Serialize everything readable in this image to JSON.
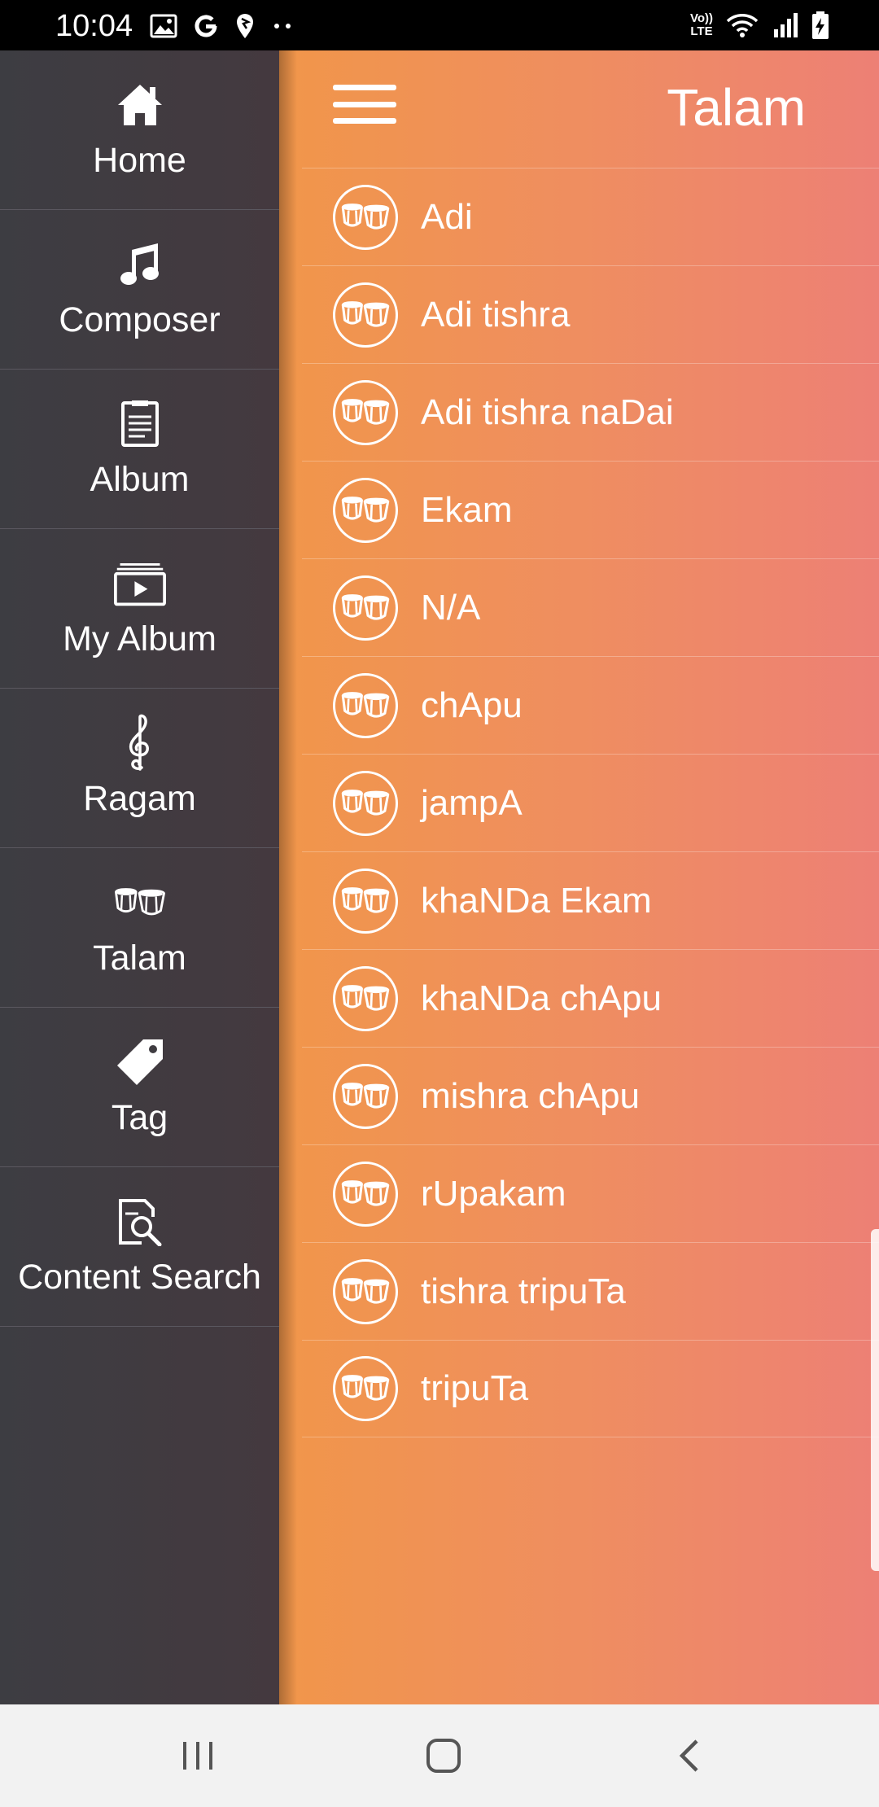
{
  "status_bar": {
    "time": "10:04",
    "left_icons": [
      "image-icon",
      "google-icon",
      "location-icon",
      "more-dots-icon"
    ],
    "volte_label_top": "Vo))",
    "volte_label_bottom": "LTE",
    "right_icons": [
      "wifi-icon",
      "signal-icon",
      "battery-charging-icon"
    ]
  },
  "drawer": {
    "items": [
      {
        "label": "Home",
        "icon": "home-icon"
      },
      {
        "label": "Composer",
        "icon": "music-note-icon"
      },
      {
        "label": "Album",
        "icon": "album-sheet-icon"
      },
      {
        "label": "My Album",
        "icon": "video-folder-icon"
      },
      {
        "label": "Ragam",
        "icon": "treble-clef-icon"
      },
      {
        "label": "Talam",
        "icon": "drums-icon"
      },
      {
        "label": "Tag",
        "icon": "tag-icon"
      },
      {
        "label": "Content Search",
        "icon": "content-search-icon"
      }
    ]
  },
  "toolbar": {
    "title": "Talam",
    "menu_icon": "hamburger-menu-icon"
  },
  "talam_list": {
    "items": [
      "Adi",
      "Adi tishra",
      "Adi tishra naDai",
      "Ekam",
      "N/A",
      "chApu",
      "jampA",
      "khaNDa Ekam",
      "khaNDa chApu",
      "mishra chApu",
      "rUpakam",
      "tishra tripuTa",
      "tripuTa"
    ]
  },
  "colors": {
    "drawer_bg": "#3d3d42",
    "content_gradient_start": "#f1964a",
    "content_gradient_end": "#ed8075",
    "navbar_bg": "#f2f2f2"
  },
  "nav_bar": {
    "buttons": [
      "recent-apps-icon",
      "home-circle-icon",
      "back-icon"
    ]
  }
}
